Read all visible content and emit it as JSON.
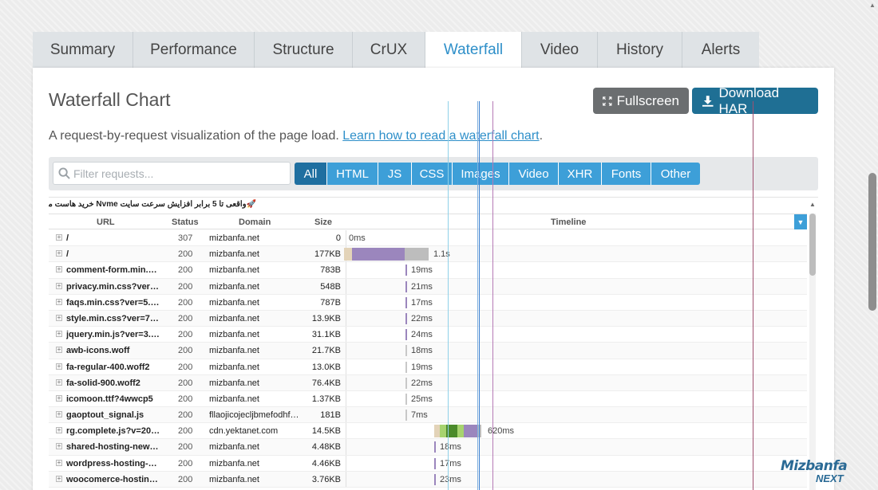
{
  "tabs": [
    {
      "label": "Summary"
    },
    {
      "label": "Performance"
    },
    {
      "label": "Structure"
    },
    {
      "label": "CrUX"
    },
    {
      "label": "Waterfall"
    },
    {
      "label": "Video"
    },
    {
      "label": "History"
    },
    {
      "label": "Alerts"
    }
  ],
  "active_tab": "Waterfall",
  "card": {
    "title": "Waterfall Chart",
    "fullscreen_label": "Fullscreen",
    "download_label": "Download HAR",
    "subtitle": "A request-by-request visualization of the page load.",
    "learn_link": "Learn how to read a waterfall chart",
    "subtitle_end": "."
  },
  "filter": {
    "placeholder": "Filter requests...",
    "buttons": [
      "All",
      "HTML",
      "JS",
      "CSS",
      "Images",
      "Video",
      "XHR",
      "Fonts",
      "Other"
    ]
  },
  "waterfall": {
    "page_title": "🚀واقعی تا 5 برابر افزایش سرعت سایت Nvme خرید هاست ماهانه",
    "columns": {
      "url": "URL",
      "status": "Status",
      "domain": "Domain",
      "size": "Size",
      "timeline": "Timeline"
    },
    "rows": [
      {
        "url": "/",
        "status": "307",
        "domain": "mizbanfa.net",
        "size": "0",
        "duration": "0ms"
      },
      {
        "url": "/",
        "status": "200",
        "domain": "mizbanfa.net",
        "size": "177KB",
        "duration": "1.1s"
      },
      {
        "url": "comment-form.min.…",
        "status": "200",
        "domain": "mizbanfa.net",
        "size": "783B",
        "duration": "19ms"
      },
      {
        "url": "privacy.min.css?ver…",
        "status": "200",
        "domain": "mizbanfa.net",
        "size": "548B",
        "duration": "21ms"
      },
      {
        "url": "faqs.min.css?ver=5.…",
        "status": "200",
        "domain": "mizbanfa.net",
        "size": "787B",
        "duration": "17ms"
      },
      {
        "url": "style.min.css?ver=7…",
        "status": "200",
        "domain": "mizbanfa.net",
        "size": "13.9KB",
        "duration": "22ms"
      },
      {
        "url": "jquery.min.js?ver=3.…",
        "status": "200",
        "domain": "mizbanfa.net",
        "size": "31.1KB",
        "duration": "24ms"
      },
      {
        "url": "awb-icons.woff",
        "status": "200",
        "domain": "mizbanfa.net",
        "size": "21.7KB",
        "duration": "18ms"
      },
      {
        "url": "fa-regular-400.woff2",
        "status": "200",
        "domain": "mizbanfa.net",
        "size": "13.0KB",
        "duration": "19ms"
      },
      {
        "url": "fa-solid-900.woff2",
        "status": "200",
        "domain": "mizbanfa.net",
        "size": "76.4KB",
        "duration": "22ms"
      },
      {
        "url": "icomoon.ttf?4wwcp5",
        "status": "200",
        "domain": "mizbanfa.net",
        "size": "1.37KB",
        "duration": "25ms"
      },
      {
        "url": "gaoptout_signal.js",
        "status": "200",
        "domain": "fllaojicojecljbmefodhf…",
        "size": "181B",
        "duration": "7ms"
      },
      {
        "url": "rg.complete.js?v=20…",
        "status": "200",
        "domain": "cdn.yektanet.com",
        "size": "14.5KB",
        "duration": "620ms"
      },
      {
        "url": "shared-hosting-new…",
        "status": "200",
        "domain": "mizbanfa.net",
        "size": "4.48KB",
        "duration": "18ms"
      },
      {
        "url": "wordpress-hosting-…",
        "status": "200",
        "domain": "mizbanfa.net",
        "size": "4.46KB",
        "duration": "17ms"
      },
      {
        "url": "woocomerce-hostin…",
        "status": "200",
        "domain": "mizbanfa.net",
        "size": "3.76KB",
        "duration": "23ms"
      }
    ]
  },
  "logo": {
    "line1": "Mizbanfa",
    "line2": "NEXT"
  },
  "colors": {
    "accent": "#2e8fc9",
    "download": "#1f6f94",
    "fullscreen": "#6b6e70",
    "filter": "#3d9fd8",
    "filter_active": "#1f6fa0"
  }
}
